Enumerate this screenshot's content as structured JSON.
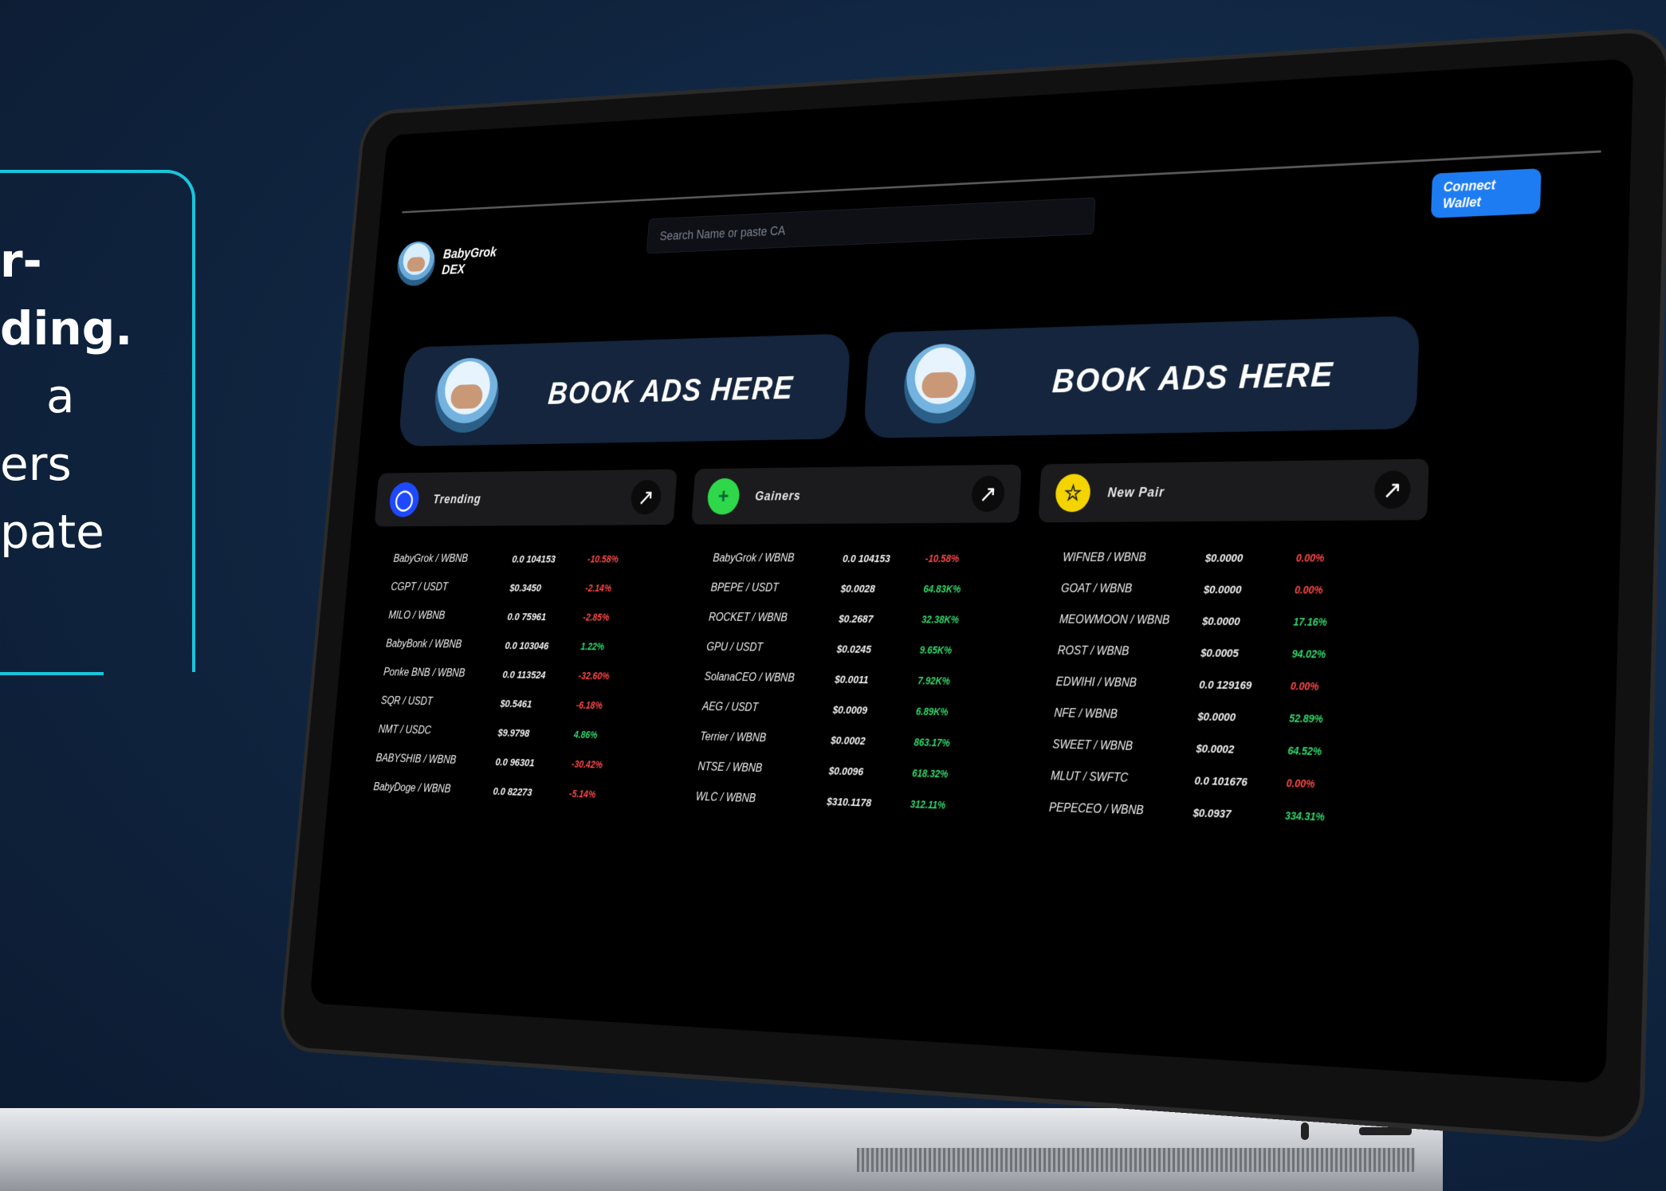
{
  "promo": {
    "lines": [
      "r-",
      "ding.",
      "a",
      "ers",
      "pate"
    ]
  },
  "header": {
    "logo_line1": "BabyGrok",
    "logo_line2": "DEX",
    "search_placeholder": "Search Name or paste CA",
    "connect_label": "Connect Wallet"
  },
  "ads": {
    "banner1": "BOOK ADS HERE",
    "banner2": "BOOK ADS HERE"
  },
  "panels": {
    "trending": {
      "title": "Trending",
      "rows": [
        {
          "pair": "BabyGrok / WBNB",
          "price": "0.0 104153",
          "change": "-10.58%",
          "dir": "down"
        },
        {
          "pair": "CGPT / USDT",
          "price": "$0.3450",
          "change": "-2.14%",
          "dir": "down"
        },
        {
          "pair": "MILO / WBNB",
          "price": "0.0 75961",
          "change": "-2.85%",
          "dir": "down"
        },
        {
          "pair": "BabyBonk / WBNB",
          "price": "0.0 103046",
          "change": "1.22%",
          "dir": "up"
        },
        {
          "pair": "Ponke BNB / WBNB",
          "price": "0.0 113524",
          "change": "-32.60%",
          "dir": "down"
        },
        {
          "pair": "SQR / USDT",
          "price": "$0.5461",
          "change": "-6.18%",
          "dir": "down"
        },
        {
          "pair": "NMT / USDC",
          "price": "$9.9798",
          "change": "4.86%",
          "dir": "up"
        },
        {
          "pair": "BABYSHIB / WBNB",
          "price": "0.0 96301",
          "change": "-30.42%",
          "dir": "down"
        },
        {
          "pair": "BabyDoge / WBNB",
          "price": "0.0 82273",
          "change": "-5.14%",
          "dir": "down"
        }
      ]
    },
    "gainers": {
      "title": "Gainers",
      "rows": [
        {
          "pair": "BabyGrok / WBNB",
          "price": "0.0 104153",
          "change": "-10.58%",
          "dir": "down"
        },
        {
          "pair": "BPEPE / USDT",
          "price": "$0.0028",
          "change": "64.83K%",
          "dir": "up"
        },
        {
          "pair": "ROCKET / WBNB",
          "price": "$0.2687",
          "change": "32.38K%",
          "dir": "up"
        },
        {
          "pair": "GPU / USDT",
          "price": "$0.0245",
          "change": "9.65K%",
          "dir": "up"
        },
        {
          "pair": "SolanaCEO / WBNB",
          "price": "$0.0011",
          "change": "7.92K%",
          "dir": "up"
        },
        {
          "pair": "AEG / USDT",
          "price": "$0.0009",
          "change": "6.89K%",
          "dir": "up"
        },
        {
          "pair": "Terrier / WBNB",
          "price": "$0.0002",
          "change": "863.17%",
          "dir": "up"
        },
        {
          "pair": "NTSE / WBNB",
          "price": "$0.0096",
          "change": "618.32%",
          "dir": "up"
        },
        {
          "pair": "WLC / WBNB",
          "price": "$310.1178",
          "change": "312.11%",
          "dir": "up"
        }
      ]
    },
    "new_pair": {
      "title": "New Pair",
      "rows": [
        {
          "pair": "WIFNEB / WBNB",
          "price": "$0.0000",
          "change": "0.00%",
          "dir": "down"
        },
        {
          "pair": "GOAT / WBNB",
          "price": "$0.0000",
          "change": "0.00%",
          "dir": "down"
        },
        {
          "pair": "MEOWMOON / WBNB",
          "price": "$0.0000",
          "change": "17.16%",
          "dir": "up"
        },
        {
          "pair": "ROST / WBNB",
          "price": "$0.0005",
          "change": "94.02%",
          "dir": "up"
        },
        {
          "pair": "EDWIHI / WBNB",
          "price": "0.0 129169",
          "change": "0.00%",
          "dir": "down"
        },
        {
          "pair": "NFE / WBNB",
          "price": "$0.0000",
          "change": "52.89%",
          "dir": "up"
        },
        {
          "pair": "SWEET / WBNB",
          "price": "$0.0002",
          "change": "64.52%",
          "dir": "up"
        },
        {
          "pair": "MLUT / SWFTC",
          "price": "0.0 101676",
          "change": "0.00%",
          "dir": "down"
        },
        {
          "pair": "PEPECEO / WBNB",
          "price": "$0.0937",
          "change": "334.31%",
          "dir": "up"
        }
      ]
    }
  },
  "colors": {
    "up": "#31d86a",
    "down": "#ff4747",
    "accent": "#1e7cf2",
    "promo_border": "#19c6dc"
  },
  "icons": {
    "trending": "flame-icon",
    "gainers": "plus-icon",
    "new_pair": "star-icon",
    "open": "arrow-up-right-icon"
  }
}
